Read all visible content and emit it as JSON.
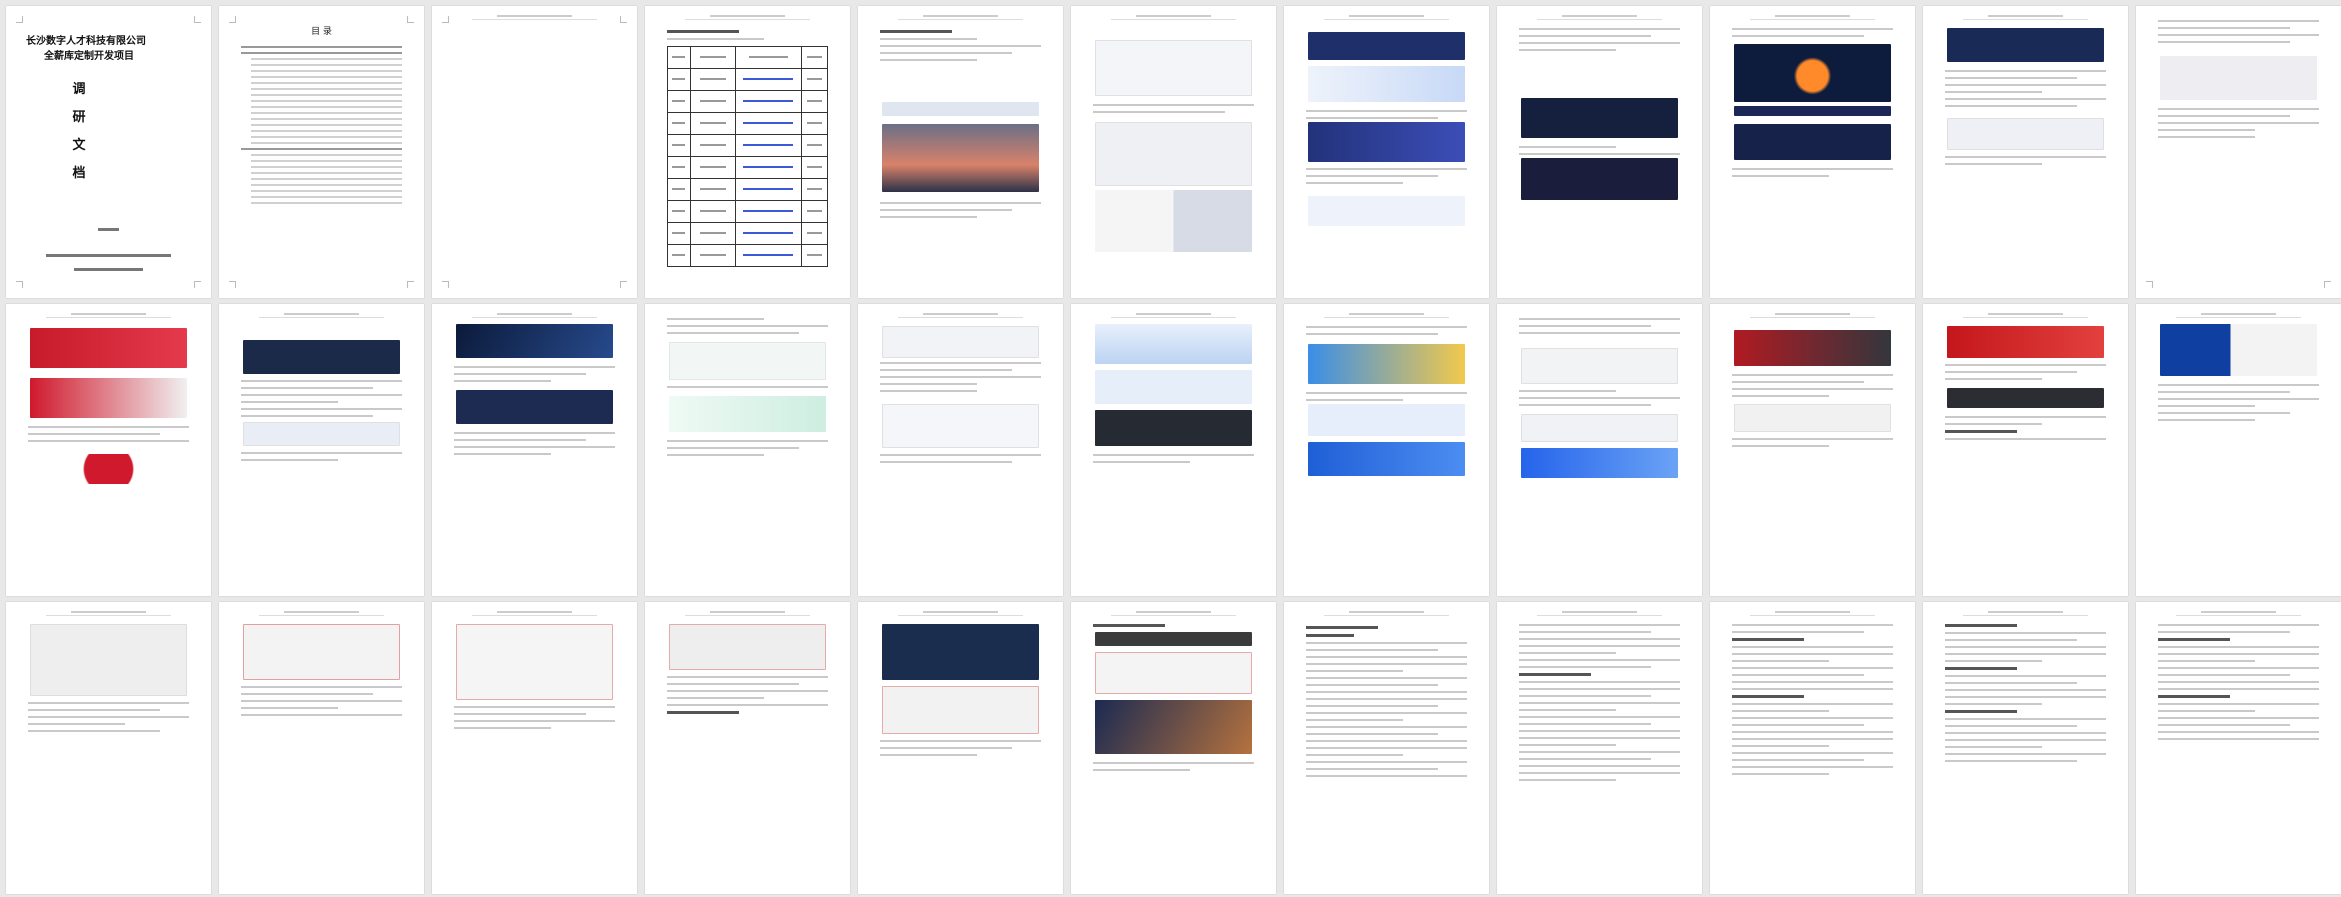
{
  "cover": {
    "company": "长沙数字人才科技有限公司",
    "project": "全薪库定制开发项目",
    "doc_chars": [
      "调",
      "研",
      "文",
      "档"
    ]
  },
  "toc": {
    "title": "目  录"
  },
  "colors": {
    "page_bg": "#ffffff",
    "canvas_bg": "#e8e8e8",
    "link_blue": "#3b5bd6",
    "dark_navy": "#1c2a4a",
    "brand_red": "#d0192d"
  }
}
